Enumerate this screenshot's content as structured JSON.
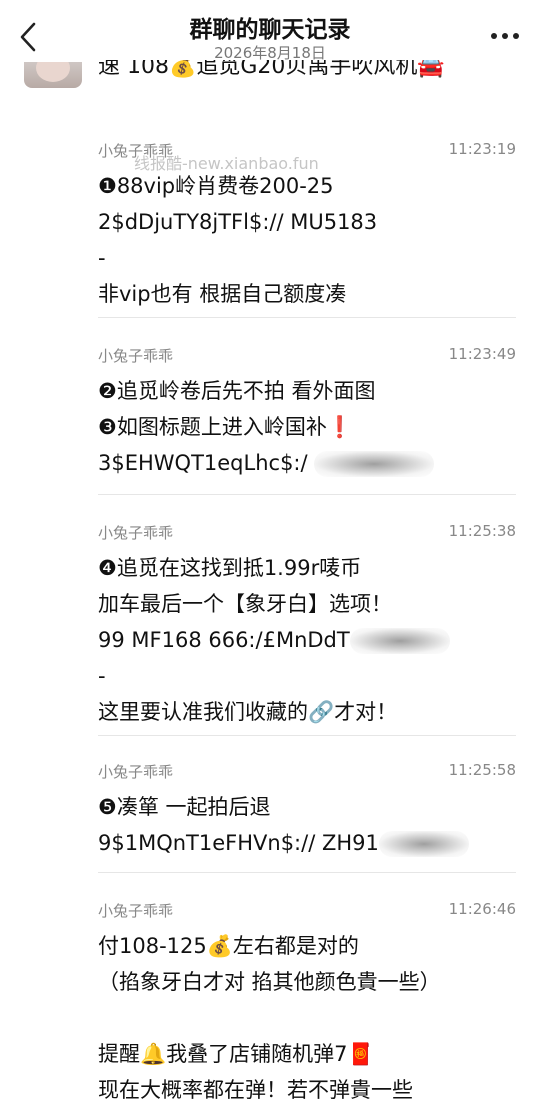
{
  "header": {
    "title": "群聊的聊天记录",
    "date": "2026年8月18日"
  },
  "previous_message": {
    "text": "速 108💰追觅G20贝禹手吹风机🚘"
  },
  "watermark": "线报酷-new.xianbao.fun",
  "messages": [
    {
      "sender": "小兔子乖乖",
      "time": "11:23:19",
      "lines": [
        "❶88vip岭肖费卷200-25",
        "2$dDjuTY8jTFl$:// MU5183",
        "-",
        "非vip也有 根据自己额度凑"
      ]
    },
    {
      "sender": "小兔子乖乖",
      "time": "11:23:49",
      "lines": [
        "❷追觅岭卷后先不拍 看外面图",
        "❸如图标题上进入岭国补❗",
        "3$EHWQT1eqLhc$:/ "
      ]
    },
    {
      "sender": "小兔子乖乖",
      "time": "11:25:38",
      "lines": [
        "❹追觅在这找到抵1.99r唛币",
        "加车最后一个【象牙白】选项！",
        "99 MF168 666:/£MnDdT",
        "-",
        "这里要认准我们收藏的🔗才对！"
      ]
    },
    {
      "sender": "小兔子乖乖",
      "time": "11:25:58",
      "lines": [
        "❺凑箪 一起拍后退",
        "9$1MQnT1eFHVn$:// ZH91"
      ]
    },
    {
      "sender": "小兔子乖乖",
      "time": "11:26:46",
      "lines": [
        "付108-125💰左右都是对的",
        "（掐象牙白才对 掐其他颜色貴一些）",
        "",
        "提醒🔔我叠了店铺随机弹7🧧",
        "现在大概率都在弹！若不弹貴一些"
      ]
    }
  ]
}
